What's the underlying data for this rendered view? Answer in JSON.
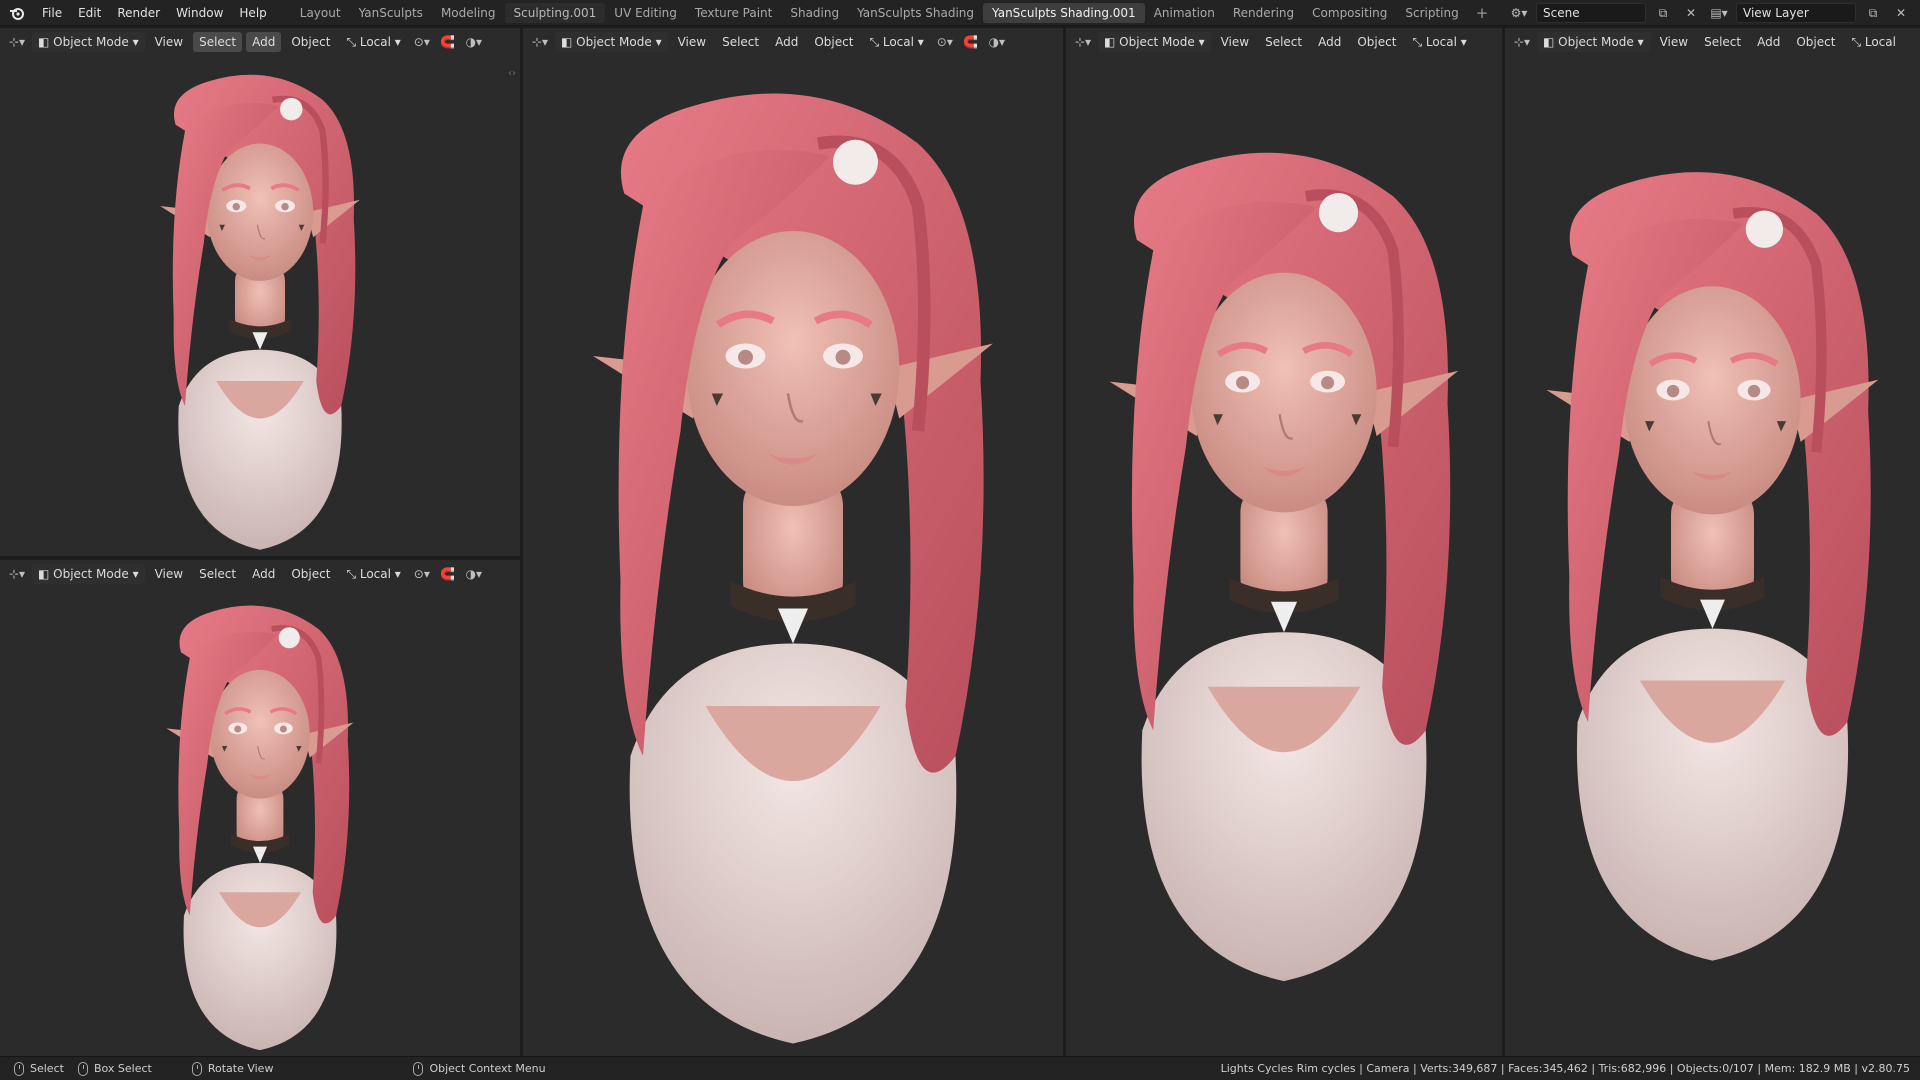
{
  "menubar": {
    "items": [
      "File",
      "Edit",
      "Render",
      "Window",
      "Help"
    ],
    "workspaces": [
      "Layout",
      "YanSculpts",
      "Modeling",
      "Sculpting.001",
      "UV Editing",
      "Texture Paint",
      "Shading",
      "YanSculpts Shading",
      "YanSculpts Shading.001",
      "Animation",
      "Rendering",
      "Compositing",
      "Scripting"
    ],
    "add_tab": "+",
    "scene_name": "Scene",
    "view_layer": "View Layer"
  },
  "viewport_header": {
    "mode": "Object Mode",
    "view": "View",
    "select": "Select",
    "add": "Add",
    "object": "Object",
    "transform": "Local"
  },
  "statusbar": {
    "select": "Select",
    "box_select": "Box Select",
    "rotate_view": "Rotate View",
    "context_menu": "Object Context Menu",
    "stats": "Lights Cycles Rim cycles | Camera | Verts:349,687 | Faces:345,462 | Tris:682,996 | Objects:0/107 | Mem: 182.9 MB | v2.80.75"
  },
  "colors": {
    "hair": "#e67a85",
    "hair_dark": "#b94f5c",
    "skin": "#e8b0a6",
    "cloth": "#e9d8d6",
    "choker": "#3a2e28",
    "viewport_bg": "#2b2b2b"
  }
}
